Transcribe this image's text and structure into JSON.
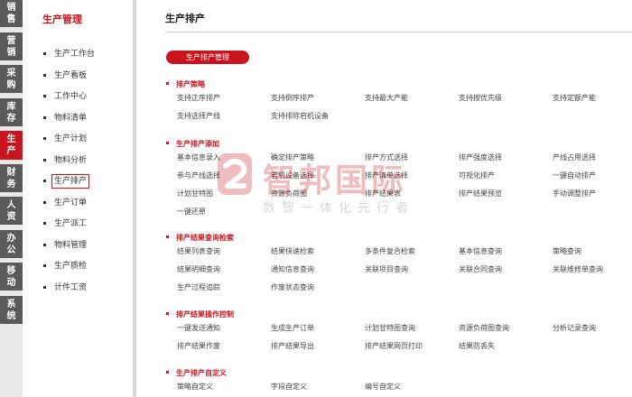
{
  "leftnav": [
    {
      "label": "销售",
      "active": false
    },
    {
      "label": "营销",
      "active": false
    },
    {
      "label": "采购",
      "active": false
    },
    {
      "label": "库存",
      "active": false
    },
    {
      "label": "生产",
      "active": true
    },
    {
      "label": "财务",
      "active": false
    },
    {
      "label": "人资",
      "active": false
    },
    {
      "label": "办公",
      "active": false
    },
    {
      "label": "移动",
      "active": false
    },
    {
      "label": "系统",
      "active": false
    }
  ],
  "sidebar": {
    "title": "生产管理",
    "items": [
      "生产工作台",
      "生产看板",
      "工作中心",
      "物料清单",
      "生产计划",
      "物料分析",
      "生产排产",
      "生产订单",
      "生产派工",
      "物料管理",
      "生产质检",
      "计件工资"
    ],
    "selected": "生产排产"
  },
  "main": {
    "title": "生产排产",
    "pill": "生产排产管理",
    "sections": [
      {
        "title": "排产策略",
        "items": [
          "支持正序排产",
          "支持倒序排产",
          "支持最大产能",
          "支持按优先级",
          "支持定额产能",
          "支持选择产线",
          "支持排除宕机设备"
        ]
      },
      {
        "title": "生产排产添加",
        "items": [
          "基本信息录入",
          "确定排产策略",
          "排产方式选择",
          "排产强度选择",
          "产线占用选择",
          "参与产线选择",
          "若机设备选择",
          "排产清单选择",
          "可视化排产",
          "一键自动排产",
          "计划甘特图",
          "资源负荷图",
          "排产结果表",
          "排产结果预览",
          "手动调整排产",
          "一键还原"
        ]
      },
      {
        "title": "排产结果查询检索",
        "items": [
          "结果列表查询",
          "结果快速检索",
          "多条件复合检索",
          "基本信息查询",
          "策略查询",
          "结果明细查询",
          "通知信息查询",
          "关联项目查询",
          "关联合同查询",
          "关联维修单查询",
          "生产过程追踪",
          "作废状态查询"
        ]
      },
      {
        "title": "排产结果操作控制",
        "items": [
          "一键发送通知",
          "生成生产订单",
          "计划甘特图查询",
          "资源负荷图查询",
          "分析记录查询",
          "排产结果作废",
          "排产结果导出",
          "排产结果网页打印",
          "结果防丢失"
        ]
      },
      {
        "title": "生产排产自定义",
        "items": [
          "策略自定义",
          "字段自定义",
          "编号自定义"
        ]
      }
    ]
  },
  "watermark": {
    "logo_icon": "zhibang-logo-icon",
    "text": "智邦国际",
    "subtitle": "数智一体化先行者"
  },
  "colors": {
    "accent": "#c8141d",
    "nav_bg": "#5a5a5a"
  }
}
